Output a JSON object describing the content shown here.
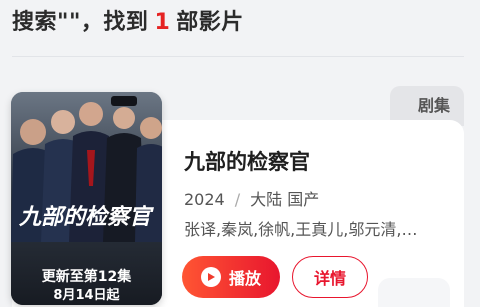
{
  "search": {
    "prefix": "搜索\"\"，找到",
    "count": "1",
    "suffix": "部影片"
  },
  "result": {
    "type_tag": "剧集",
    "title": "九部的检察官",
    "year": "2024",
    "separator": "/",
    "region": "大陆 国产",
    "cast": "张译,秦岚,徐帆,王真儿,邬元清,贾...",
    "poster": {
      "title_art": "九部的检察官",
      "update_text": "更新至第12集",
      "date_text": "8月14日起"
    },
    "play_label": "播放",
    "detail_label": "详情"
  },
  "colors": {
    "accent": "#e8162e",
    "background": "#f2f3f5"
  }
}
